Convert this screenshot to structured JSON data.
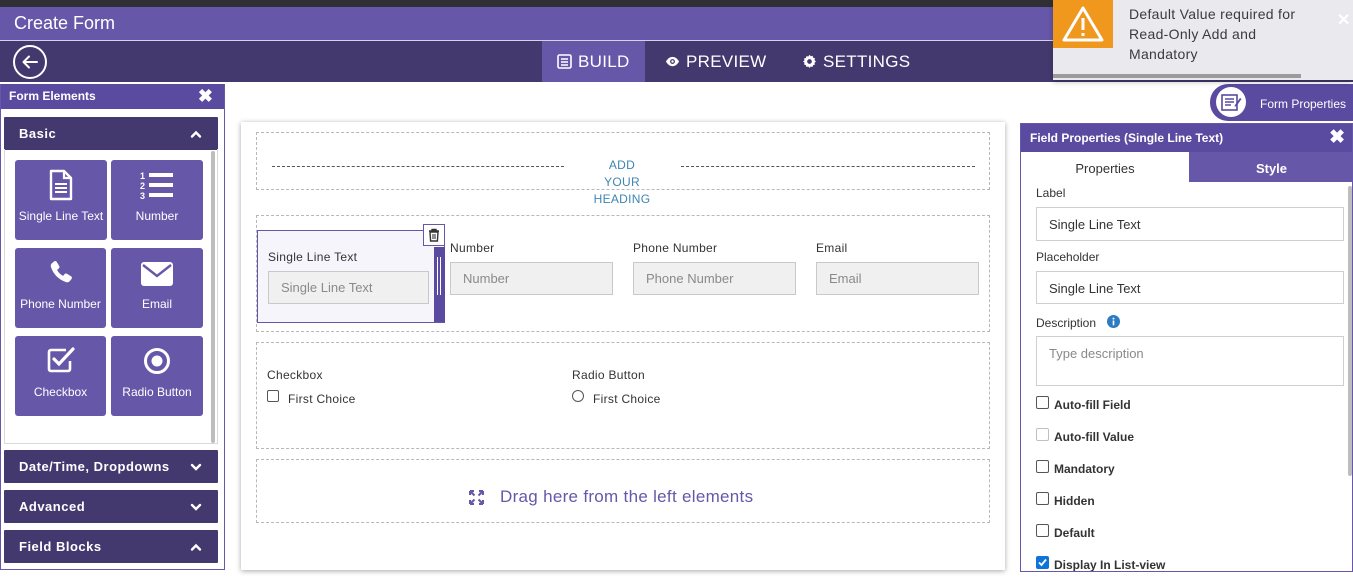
{
  "title": "Create Form",
  "nav": {
    "tabs": [
      {
        "label": "BUILD",
        "icon": "list-icon",
        "active": true
      },
      {
        "label": "PREVIEW",
        "icon": "eye-icon",
        "active": false
      },
      {
        "label": "SETTINGS",
        "icon": "gear-icon",
        "active": false
      }
    ]
  },
  "left": {
    "title": "Form Elements",
    "sections": {
      "basic": "Basic",
      "datetime": "Date/Time, Dropdowns",
      "advanced": "Advanced",
      "blocks": "Field Blocks"
    },
    "tiles": [
      {
        "label": "Single Line Text",
        "icon": "document-icon"
      },
      {
        "label": "Number",
        "icon": "numbered-list-icon"
      },
      {
        "label": "Phone Number",
        "icon": "phone-icon"
      },
      {
        "label": "Email",
        "icon": "envelope-icon"
      },
      {
        "label": "Checkbox",
        "icon": "checkbox-icon"
      },
      {
        "label": "Radio Button",
        "icon": "radio-icon"
      }
    ]
  },
  "canvas": {
    "heading_line1": "ADD YOUR",
    "heading_line2": "HEADING",
    "row1": [
      {
        "label": "Single Line Text",
        "placeholder": "Single Line Text"
      },
      {
        "label": "Number",
        "placeholder": "Number"
      },
      {
        "label": "Phone Number",
        "placeholder": "Phone Number"
      },
      {
        "label": "Email",
        "placeholder": "Email"
      }
    ],
    "checkbox": {
      "label": "Checkbox",
      "option": "First Choice"
    },
    "radio": {
      "label": "Radio Button",
      "option": "First Choice"
    },
    "drop_hint": "Drag here from the left elements"
  },
  "form_properties": "Form Properties",
  "right": {
    "title": "Field Properties (Single Line Text)",
    "tab_properties": "Properties",
    "tab_style": "Style",
    "label_caption": "Label",
    "label_value": "Single Line Text",
    "placeholder_caption": "Placeholder",
    "placeholder_value": "Single Line Text",
    "description_caption": "Description",
    "description_placeholder": "Type description",
    "options": [
      {
        "label": "Auto-fill Field",
        "checked": false,
        "disabled": false
      },
      {
        "label": "Auto-fill Value",
        "checked": false,
        "disabled": true
      },
      {
        "label": "Mandatory",
        "checked": false,
        "disabled": false
      },
      {
        "label": "Hidden",
        "checked": false,
        "disabled": false
      },
      {
        "label": "Default",
        "checked": false,
        "disabled": false
      },
      {
        "label": "Display In List-view",
        "checked": true,
        "disabled": false
      }
    ]
  },
  "toast": {
    "line1": "Default Value required for",
    "line2": "Read-Only Add and",
    "line3": "Mandatory"
  },
  "colors": {
    "primary": "#6757a9",
    "dark": "#43396f",
    "warning": "#f0971e",
    "link": "#3d86b3"
  }
}
